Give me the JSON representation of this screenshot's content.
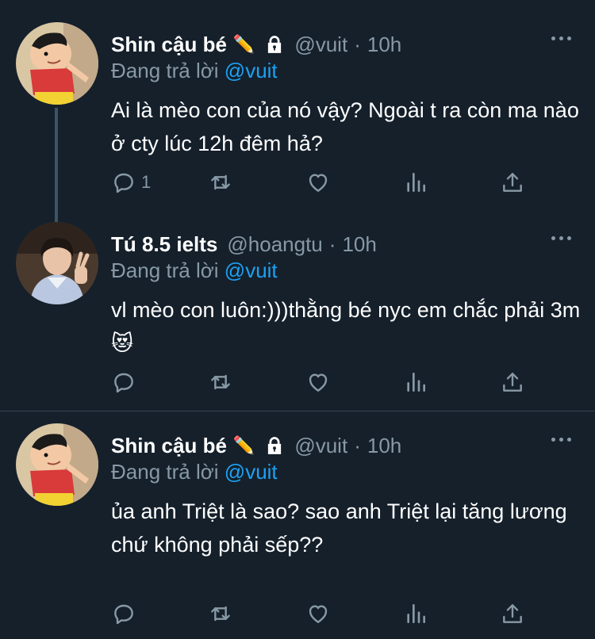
{
  "tweets": [
    {
      "name": "Shin cậu bé",
      "name_emoji": "✏️",
      "handle": "@vuit",
      "time": "10h",
      "reply_prefix": "Đang trả lời",
      "reply_to": "@vuit",
      "text": "Ai là mèo con của nó vậy? Ngoài t ra còn ma nào ở cty lúc 12h đêm hả?",
      "reply_count": "1",
      "locked": true
    },
    {
      "name": "Tú 8.5 ielts",
      "handle": "@hoangtu",
      "time": "10h",
      "reply_prefix": "Đang trả lời",
      "reply_to": "@vuit",
      "text": "vl mèo con luôn:)))thằng bé nyc em chắc phải 3m😻",
      "reply_count": "",
      "locked": false
    },
    {
      "name": "Shin cậu bé",
      "name_emoji": "✏️",
      "handle": "@vuit",
      "time": "10h",
      "reply_prefix": "Đang trả lời",
      "reply_to": "@vuit",
      "text": "ủa anh Triệt là sao? sao anh Triệt lại tăng lương chứ không phải sếp??",
      "reply_count": "",
      "locked": true
    }
  ],
  "colors": {
    "background": "#15202b",
    "secondary_text": "#8899a6",
    "mention": "#1da1f2",
    "divider": "#38444d",
    "thread_line": "#3d5466"
  },
  "separator": "·"
}
